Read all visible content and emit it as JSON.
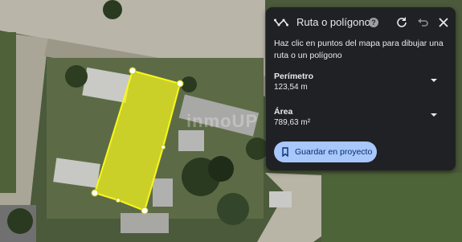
{
  "map": {
    "watermark": "inmoUP",
    "colors": {
      "polygon_fill": "#f7f71e",
      "polygon_stroke": "#f7f71e",
      "vertex": "#ffffff"
    }
  },
  "panel": {
    "title": "Ruta o polígono",
    "description": "Haz clic en puntos del mapa para dibujar una ruta o un polígono",
    "perimeter": {
      "label": "Perímetro",
      "value": "123,54 m"
    },
    "area": {
      "label": "Área",
      "value": "789,63 m²"
    },
    "save_label": "Guardar en proyecto",
    "icons": [
      "route-icon",
      "help-icon",
      "reset-icon",
      "undo-icon",
      "close-icon",
      "chevron-down-icon",
      "bookmark-icon"
    ],
    "colors": {
      "background": "#202124",
      "button": "#a8c7fa",
      "button_text": "#062e6f"
    }
  }
}
